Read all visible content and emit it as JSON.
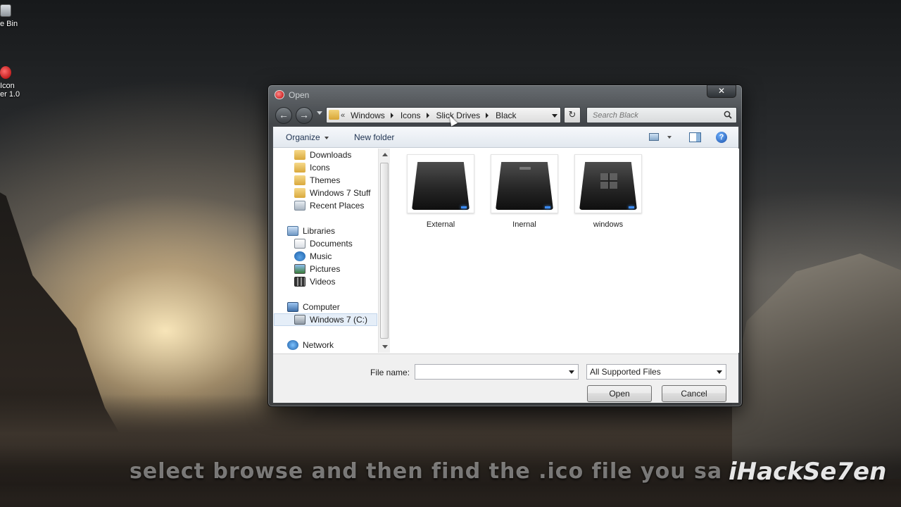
{
  "desktop": {
    "recycle_label": "e Bin",
    "iconapp_label_line1": "Icon",
    "iconapp_label_line2": "er 1.0"
  },
  "dialog": {
    "title": "Open",
    "close_symbol": "✕",
    "breadcrumbs": {
      "overflow": "«",
      "items": [
        "Windows",
        "Icons",
        "Slick Drives",
        "Black"
      ]
    },
    "search": {
      "placeholder": "Search Black",
      "value": ""
    },
    "toolbar": {
      "organize": "Organize",
      "new_folder": "New folder",
      "help": "?"
    },
    "nav_pane": {
      "favorites": [
        "Downloads",
        "Icons",
        "Themes",
        "Windows 7 Stuff",
        "Recent Places"
      ],
      "libraries_header": "Libraries",
      "libraries": [
        "Documents",
        "Music",
        "Pictures",
        "Videos"
      ],
      "computer_header": "Computer",
      "computer_items": [
        "Windows 7 (C:)"
      ],
      "network_header": "Network"
    },
    "files": [
      {
        "name": "External",
        "icon": "drive-icon"
      },
      {
        "name": "Inernal",
        "icon": "drive-icon"
      },
      {
        "name": "windows",
        "icon": "drive-windows-icon"
      }
    ],
    "footer": {
      "file_name_label": "File name:",
      "file_name_value": "",
      "file_type": "All Supported Files",
      "open_button": "Open",
      "cancel_button": "Cancel"
    }
  },
  "overlay": {
    "caption": "select browse and then find the .ico file you sa",
    "watermark": "iHackSe7en"
  },
  "colors": {
    "accent": "#3b8cff",
    "dialog_glass": "#464a4e"
  }
}
